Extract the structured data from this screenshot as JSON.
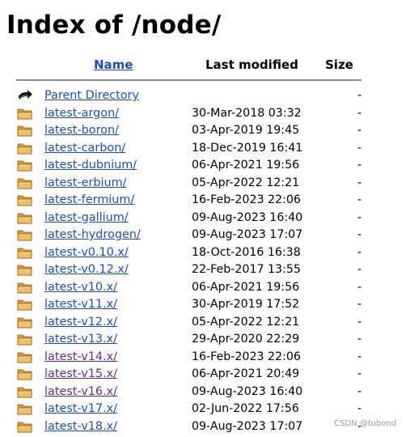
{
  "page": {
    "title": "Index of /node/"
  },
  "columns": {
    "name": "Name",
    "modified": "Last modified",
    "size": "Size"
  },
  "colors": {
    "link": "#1a4ec5",
    "visited": "#6a2a8a",
    "folder": "#e8b04c"
  },
  "parent": {
    "label": "Parent Directory",
    "date": "",
    "size": "-",
    "icon": "back-arrow-icon"
  },
  "entries": [
    {
      "name": "latest-argon/",
      "date": "30-Mar-2018 03:32",
      "size": "-",
      "visited": false
    },
    {
      "name": "latest-boron/",
      "date": "03-Apr-2019 19:45",
      "size": "-",
      "visited": false
    },
    {
      "name": "latest-carbon/",
      "date": "18-Dec-2019 16:41",
      "size": "-",
      "visited": false
    },
    {
      "name": "latest-dubnium/",
      "date": "06-Apr-2021 19:56",
      "size": "-",
      "visited": false
    },
    {
      "name": "latest-erbium/",
      "date": "05-Apr-2022 12:21",
      "size": "-",
      "visited": false
    },
    {
      "name": "latest-fermium/",
      "date": "16-Feb-2023 22:06",
      "size": "-",
      "visited": false
    },
    {
      "name": "latest-gallium/",
      "date": "09-Aug-2023 16:40",
      "size": "-",
      "visited": false
    },
    {
      "name": "latest-hydrogen/",
      "date": "09-Aug-2023 17:07",
      "size": "-",
      "visited": false
    },
    {
      "name": "latest-v0.10.x/",
      "date": "18-Oct-2016 16:38",
      "size": "-",
      "visited": false
    },
    {
      "name": "latest-v0.12.x/",
      "date": "22-Feb-2017 13:55",
      "size": "-",
      "visited": false
    },
    {
      "name": "latest-v10.x/",
      "date": "06-Apr-2021 19:56",
      "size": "-",
      "visited": false
    },
    {
      "name": "latest-v11.x/",
      "date": "30-Apr-2019 17:52",
      "size": "-",
      "visited": false
    },
    {
      "name": "latest-v12.x/",
      "date": "05-Apr-2022 12:21",
      "size": "-",
      "visited": false
    },
    {
      "name": "latest-v13.x/",
      "date": "29-Apr-2020 22:29",
      "size": "-",
      "visited": false
    },
    {
      "name": "latest-v14.x/",
      "date": "16-Feb-2023 22:06",
      "size": "-",
      "visited": true
    },
    {
      "name": "latest-v15.x/",
      "date": "06-Apr-2021 20:49",
      "size": "-",
      "visited": true
    },
    {
      "name": "latest-v16.x/",
      "date": "09-Aug-2023 16:40",
      "size": "-",
      "visited": true
    },
    {
      "name": "latest-v17.x/",
      "date": "02-Jun-2022 17:56",
      "size": "-",
      "visited": false
    },
    {
      "name": "latest-v18.x/",
      "date": "09-Aug-2023 17:07",
      "size": "-",
      "visited": false
    }
  ],
  "watermark": "CSDN @tubond"
}
